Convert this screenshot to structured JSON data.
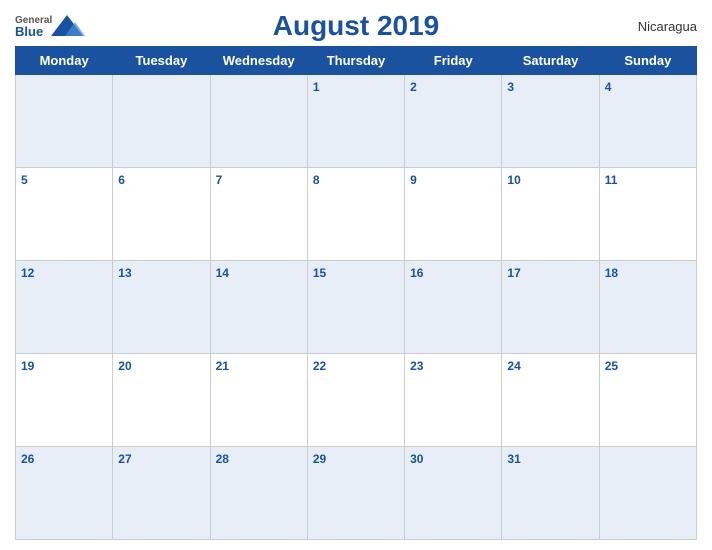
{
  "header": {
    "logo_general": "General",
    "logo_blue": "Blue",
    "title": "August 2019",
    "country": "Nicaragua"
  },
  "weekdays": [
    "Monday",
    "Tuesday",
    "Wednesday",
    "Thursday",
    "Friday",
    "Saturday",
    "Sunday"
  ],
  "weeks": [
    [
      null,
      null,
      null,
      1,
      2,
      3,
      4
    ],
    [
      5,
      6,
      7,
      8,
      9,
      10,
      11
    ],
    [
      12,
      13,
      14,
      15,
      16,
      17,
      18
    ],
    [
      19,
      20,
      21,
      22,
      23,
      24,
      25
    ],
    [
      26,
      27,
      28,
      29,
      30,
      31,
      null
    ]
  ],
  "colors": {
    "header_bg": "#1a52a0",
    "row_odd": "#e8eef8",
    "row_even": "#ffffff",
    "day_num": "#1a52a0"
  }
}
